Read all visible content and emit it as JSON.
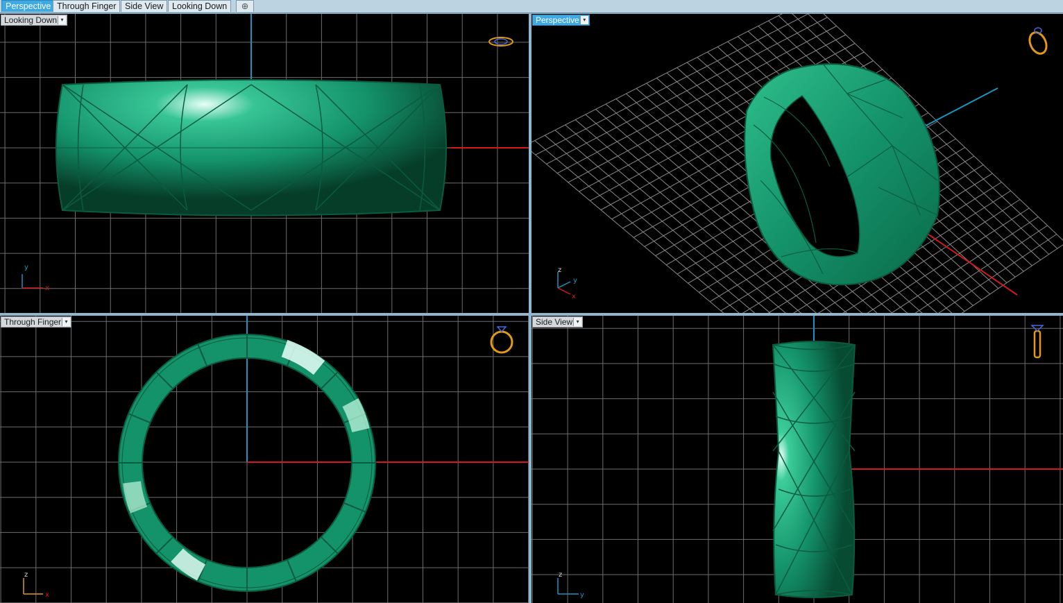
{
  "tabs": [
    {
      "label": "Perspective",
      "active": true
    },
    {
      "label": "Through Finger",
      "active": false
    },
    {
      "label": "Side View",
      "active": false
    },
    {
      "label": "Looking Down",
      "active": false
    }
  ],
  "add_tab_icon": "plus-icon",
  "viewports": {
    "top_left": {
      "label": "Looking Down",
      "axes": [
        "y",
        "x"
      ],
      "gizmo_icon": "ring-top-view-icon"
    },
    "top_right": {
      "label": "Perspective",
      "axes": [
        "z",
        "y",
        "x"
      ],
      "gizmo_icon": "ring-perspective-icon"
    },
    "bottom_left": {
      "label": "Through Finger",
      "axes": [
        "z",
        "x"
      ],
      "gizmo_icon": "ring-front-view-icon"
    },
    "bottom_right": {
      "label": "Side View",
      "axes": [
        "z",
        "y"
      ],
      "gizmo_icon": "ring-side-view-icon"
    }
  },
  "colors": {
    "ring_fill": "#14926a",
    "ring_edge": "#0a5c3f",
    "grid": "#6e6e6e",
    "axis_x": "#d31a1a",
    "axis_y": "#1896c0",
    "gizmo": "#e09a18",
    "active_tab": "#3fa9e3"
  }
}
